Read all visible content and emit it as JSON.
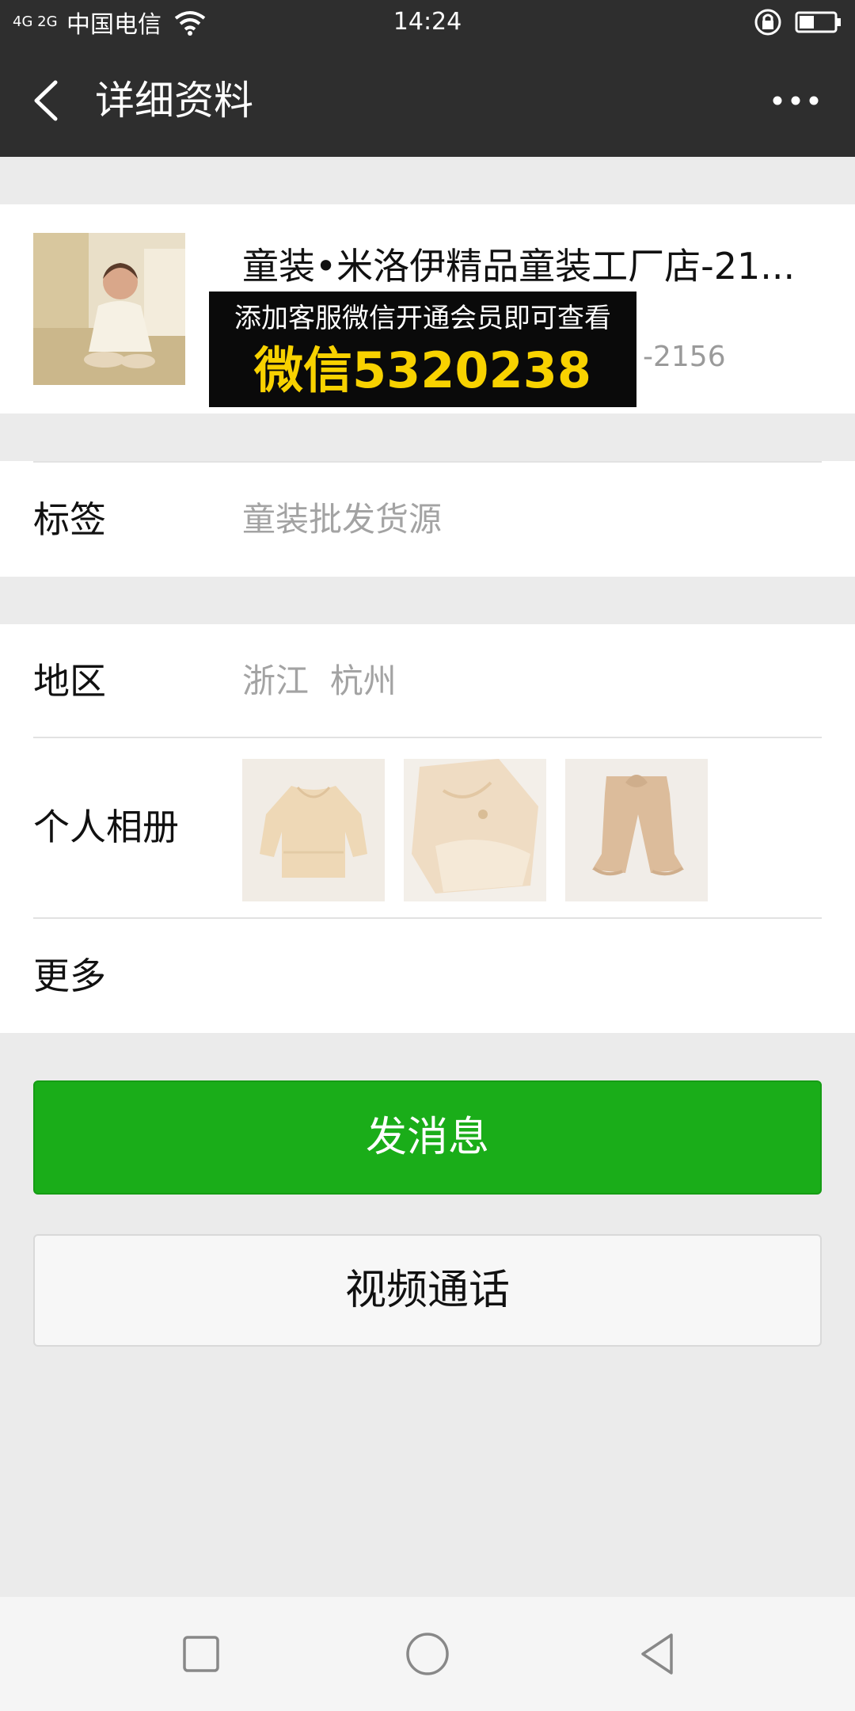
{
  "status_bar": {
    "signal": "4G 2G",
    "carrier": "中国电信",
    "time": "14:24",
    "icons": [
      "signal-icon",
      "wifi-icon",
      "lock-icon",
      "battery-icon"
    ]
  },
  "header": {
    "title": "详细资料",
    "back_icon": "chevron-left-icon",
    "more_icon": "more-icon"
  },
  "profile": {
    "name": "童装•米洛伊精品童装工厂店-21...",
    "sub_visible": "-2156",
    "ad_line1": "添加客服微信开通会员即可查看",
    "ad_line2": "微信5320238"
  },
  "tags_row": {
    "label": "标签",
    "value": "童装批发货源"
  },
  "region_row": {
    "label": "地区",
    "value": "浙江  杭州"
  },
  "album_row": {
    "label": "个人相册",
    "photos": [
      "blouse-photo",
      "lace-dress-photo",
      "pants-photo"
    ]
  },
  "more_row": {
    "label": "更多"
  },
  "actions": {
    "send_message": "发消息",
    "video_call": "视频通话"
  },
  "colors": {
    "header_bg": "#2e2e2e",
    "page_bg": "#ebebeb",
    "primary_green": "#1aad19"
  },
  "nav": {
    "icons": [
      "square-icon",
      "circle-icon",
      "triangle-back-icon"
    ]
  }
}
